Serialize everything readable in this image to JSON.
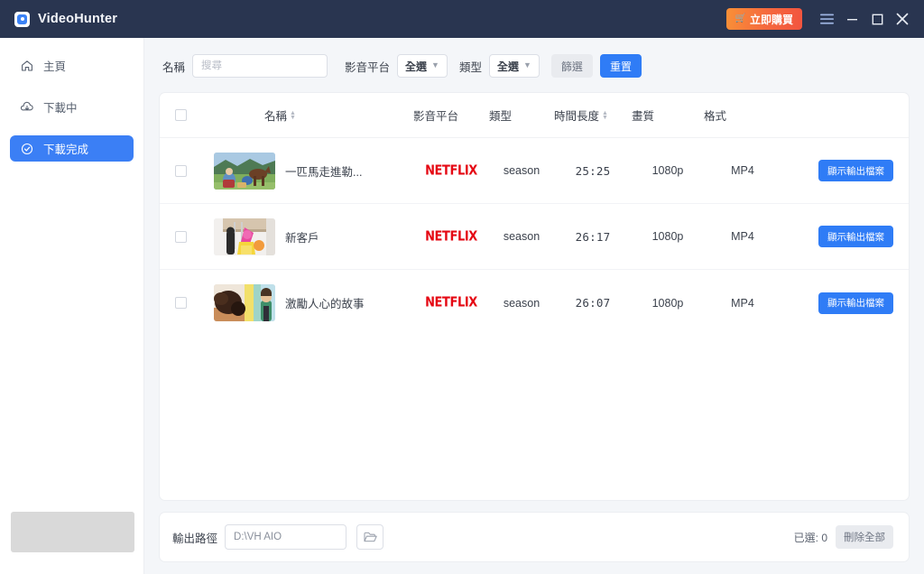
{
  "titlebar": {
    "app_name": "VideoHunter",
    "logo_icon": "app-logo-icon",
    "buy_label": "立即購買",
    "cart_icon": "cart-icon",
    "menu_icon": "hamburger-menu-icon",
    "minimize_icon": "minimize-icon",
    "maximize_icon": "maximize-icon",
    "close_icon": "close-icon"
  },
  "sidebar": {
    "items": [
      {
        "label": "主頁",
        "icon": "home-icon",
        "active": false
      },
      {
        "label": "下載中",
        "icon": "download-icon",
        "active": false
      },
      {
        "label": "下載完成",
        "icon": "check-circle-icon",
        "active": true
      }
    ]
  },
  "filterbar": {
    "name_label": "名稱",
    "search_placeholder": "搜尋",
    "search_value": "",
    "platform_label": "影音平台",
    "platform_value": "全選",
    "type_label": "類型",
    "type_value": "全選",
    "filter_button": "篩選",
    "reset_button": "重置",
    "chevron_icon": "chevron-down-icon"
  },
  "table": {
    "headers": {
      "select_all": "select-all-checkbox",
      "name": "名稱",
      "platform": "影音平台",
      "type": "類型",
      "duration": "時間長度",
      "quality": "畫質",
      "format": "格式"
    },
    "rows": [
      {
        "title": "一匹馬走進勒...",
        "platform": "NETFLIX",
        "type": "season",
        "duration": "25:25",
        "quality": "1080p",
        "format": "MP4",
        "action_label": "顯示輸出檔案",
        "thumb": "horse-landscape-thumbnail"
      },
      {
        "title": "新客戶",
        "platform": "NETFLIX",
        "type": "season",
        "duration": "26:17",
        "quality": "1080p",
        "format": "MP4",
        "action_label": "顯示輸出檔案",
        "thumb": "pink-character-thumbnail"
      },
      {
        "title": "激勵人心的故事",
        "platform": "NETFLIX",
        "type": "season",
        "duration": "26:07",
        "quality": "1080p",
        "format": "MP4",
        "action_label": "顯示輸出檔案",
        "thumb": "two-people-thumbnail"
      }
    ]
  },
  "bottombar": {
    "path_label": "輸出路徑",
    "path_value": "D:\\VH AIO",
    "folder_icon": "folder-open-icon",
    "selected_text": "已選: 0",
    "delete_all_button": "刪除全部"
  },
  "colors": {
    "titlebar_bg": "#293550",
    "accent_blue": "#2f7cf6",
    "sidebar_active": "#3b7ff5",
    "netflix_red": "#e50914",
    "buy_orange": "#f5683e",
    "main_bg": "#f4f6f9"
  }
}
